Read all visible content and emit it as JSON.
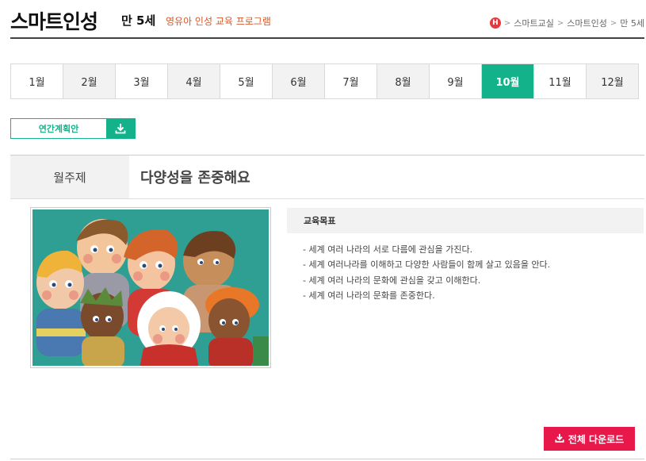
{
  "header": {
    "title": "스마트인성",
    "age": "만 5세",
    "subtitle": "영유아 인성 교육 프로그램",
    "breadcrumb": [
      "스마트교실",
      "스마트인성",
      "만 5세"
    ],
    "home_icon_letter": "H",
    "home_icon": "home-icon"
  },
  "months": [
    "1월",
    "2월",
    "3월",
    "4월",
    "5월",
    "6월",
    "7월",
    "8월",
    "9월",
    "10월",
    "11월",
    "12월"
  ],
  "active_month": "10월",
  "plan_button": {
    "label": "연간계획안",
    "icon": "download-icon"
  },
  "theme": {
    "label": "월주제",
    "value": "다양성을 존중해요"
  },
  "goals": {
    "heading": "교육목표",
    "items": [
      "- 세계 여러 나라의 서로 다름에 관심을 가진다.",
      "- 세계 여러나라를 이해하고 다양한 사람들이 함께 살고 있음을 안다.",
      "- 세계 여러 나라의 문화에 관심을 갖고 이해한다.",
      "- 세계 여러 나라의 문화를 존중한다."
    ]
  },
  "download_all": {
    "label": "전체 다운로드",
    "icon": "download-icon"
  },
  "colors": {
    "accent": "#14b28a",
    "download": "#e8184b",
    "subtitle": "#d4592a",
    "home": "#e8383d"
  }
}
